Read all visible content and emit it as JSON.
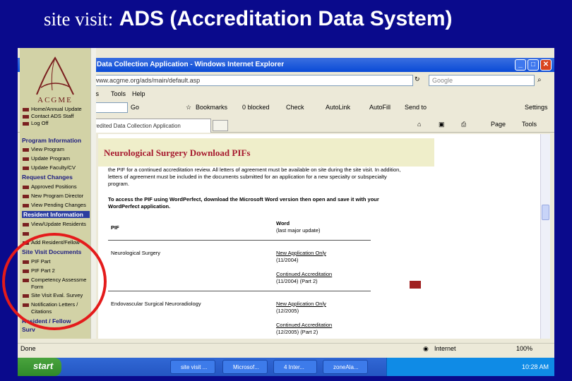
{
  "slide_title": {
    "prefix": "site visit:",
    "main": "ADS (Accreditation Data System)"
  },
  "browser": {
    "window_title": "Data Collection Application - Windows Internet Explorer",
    "address": "://www.acgme.org/ads/main/default.asp",
    "search_placeholder": "Google",
    "menu": [
      "rites",
      "Tools",
      "Help"
    ],
    "links_go": "Go",
    "bookmarks": "Bookmarks",
    "blocked": "0 blocked",
    "check": "Check",
    "autolink": "AutoLink",
    "autofill": "AutoFill",
    "send_to": "Send to",
    "settings": "Settings",
    "tab_title": "ccredited Data Collection Application",
    "cmd_page": "Page",
    "cmd_tools": "Tools",
    "status": "Done",
    "zone": "Internet",
    "zoom": "100%"
  },
  "sidebar": {
    "org": "ACGME",
    "top_links": [
      "Home/Annual Update",
      "Contact ADS Staff",
      "Log Off"
    ],
    "sections": [
      {
        "title": "Program Information",
        "highlight": false,
        "items": [
          "View Program",
          "Update Program",
          "Update Faculty/CV"
        ]
      },
      {
        "title": "Request Changes",
        "highlight": false,
        "items": [
          "Approved Positions",
          "New Program Director",
          "View Pending Changes"
        ]
      },
      {
        "title": "Resident Information",
        "highlight": true,
        "items": [
          "View/Update Residents",
          "",
          "Add Resident/Fellow"
        ]
      },
      {
        "title": "Site Visit Documents",
        "highlight": false,
        "items": [
          "PIF Part",
          "PIF Part 2",
          "Competency Assessme",
          "Form",
          "Site Visit Eval. Survey",
          "Notification Letters /",
          "Citations"
        ]
      },
      {
        "title": "Resident / Fellow",
        "highlight": false,
        "items": []
      }
    ],
    "cut_label": "Surv"
  },
  "content": {
    "heading": "Neurological Surgery Download PIFs",
    "para1": "the PIF for a continued accreditation review. All letters of agreement must be available on site during the site visit. In addition, letters of agreement must be included in the documents submitted for an application for a new specialty or subspecialty program.",
    "para2": "To access the PIF using WordPerfect, download the Microsoft Word version then open and save it with your WordPerfect application.",
    "col_pif": "PIF",
    "col_word": "Word",
    "col_word_sub": "(last major update)",
    "rows": [
      {
        "name": "Neurological Surgery",
        "entries": [
          {
            "label": "New Application Only",
            "date": "(11/2004)"
          },
          {
            "label": "Continued Accreditation",
            "date": "(11/2004)      (Part 2)"
          }
        ]
      },
      {
        "name": "Endovascular Surgical Neuroradiology",
        "entries": [
          {
            "label": "New Application Only",
            "date": "(12/2005)"
          },
          {
            "label": "Continued Accreditation",
            "date": "(12/2005)      (Part 2)"
          }
        ]
      }
    ]
  },
  "taskbar": {
    "start": "start",
    "tasks": [
      "site visit ...",
      "Microsof...",
      "4 Inter...",
      "zoneAla..."
    ],
    "clock": "10:28 AM"
  }
}
